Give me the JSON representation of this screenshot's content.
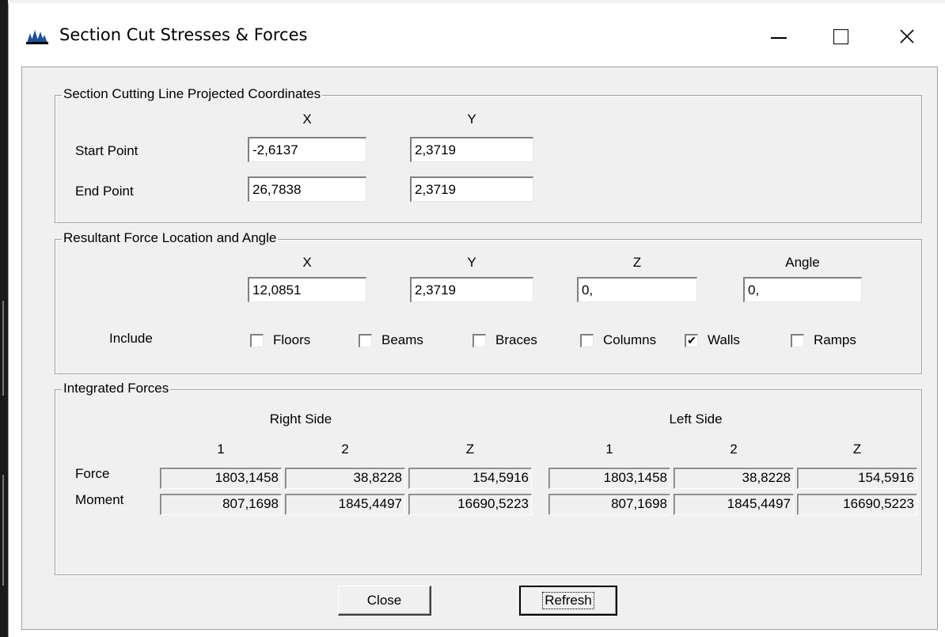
{
  "window": {
    "title": "Section Cut Stresses & Forces",
    "icon": "etabs-app-icon",
    "minimize": "minimize-icon",
    "maximize": "maximize-icon",
    "close": "close-icon"
  },
  "cutting_line": {
    "legend": "Section Cutting Line Projected Coordinates",
    "col_x": "X",
    "col_y": "Y",
    "start_label": "Start Point",
    "end_label": "End Point",
    "start_x": "-2,6137",
    "start_y": "2,3719",
    "end_x": "26,7838",
    "end_y": "2,3719"
  },
  "resultant": {
    "legend": "Resultant Force Location and Angle",
    "col_x": "X",
    "col_y": "Y",
    "col_z": "Z",
    "col_angle": "Angle",
    "x": "12,0851",
    "y": "2,3719",
    "z": "0,",
    "angle": "0,",
    "include_label": "Include",
    "checkboxes": [
      {
        "label": "Floors",
        "checked": false
      },
      {
        "label": "Beams",
        "checked": false
      },
      {
        "label": "Braces",
        "checked": false
      },
      {
        "label": "Columns",
        "checked": false
      },
      {
        "label": "Walls",
        "checked": true
      },
      {
        "label": "Ramps",
        "checked": false
      }
    ]
  },
  "integrated": {
    "legend": "Integrated Forces",
    "right_side": "Right Side",
    "left_side": "Left Side",
    "cols": [
      "1",
      "2",
      "Z",
      "1",
      "2",
      "Z"
    ],
    "force_label": "Force",
    "moment_label": "Moment",
    "force": [
      "1803,1458",
      "38,8228",
      "154,5916",
      "1803,1458",
      "38,8228",
      "154,5916"
    ],
    "moment": [
      "807,1698",
      "1845,4497",
      "16690,5223",
      "807,1698",
      "1845,4497",
      "16690,5223"
    ]
  },
  "buttons": {
    "close": "Close",
    "refresh": "Refresh"
  },
  "colors": {
    "dialog_bg": "#f0f0f0",
    "title_bg": "#ffffff",
    "border": "#a0a0a0"
  }
}
